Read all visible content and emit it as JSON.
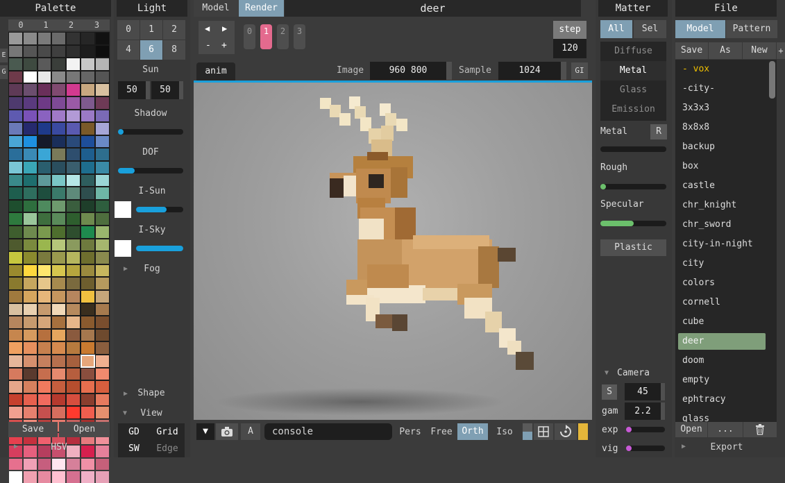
{
  "palette": {
    "title": "Palette",
    "tabs": [
      "0",
      "1",
      "2",
      "3"
    ],
    "side_tabs": [
      "E",
      "G"
    ],
    "save": "Save",
    "open": "Open",
    "hsv": "HSV",
    "colors": [
      "#9a9a9a",
      "#8a8a8a",
      "#7a7a7a",
      "#6a6a6a",
      "#333333",
      "#262626",
      "#111111",
      "#777777",
      "#555555",
      "#4a4a4a",
      "#3f3f3f",
      "#2f2f2f",
      "#1d1d1d",
      "#0e0e0e",
      "#4a5a50",
      "#3e4a40",
      "#5a5a5a",
      "#3a3e3a",
      "#f3f3f3",
      "#c7c7c7",
      "#b5b5b5",
      "#6e3a4a",
      "#ffffff",
      "#e8e8e8",
      "#8a8a8a",
      "#777777",
      "#666666",
      "#555555",
      "#5e3a56",
      "#6b4e6e",
      "#6a2f5a",
      "#804a70",
      "#d23a8f",
      "#c8a880",
      "#d8c0a0",
      "#4e3a6e",
      "#5a3a7e",
      "#6e3a86",
      "#7e4a96",
      "#9a5aa6",
      "#7e5a8e",
      "#6e3a56",
      "#5e5ab0",
      "#7a52b8",
      "#8a62c0",
      "#a07ac8",
      "#b29ad6",
      "#9a7ac6",
      "#7a6ab6",
      "#6a7ab8",
      "#262a6e",
      "#1e3a8a",
      "#3a4aa0",
      "#5a5ab0",
      "#7a5a2a",
      "#a6a6d6",
      "#4aa6d6",
      "#1e90e0",
      "#151a2a",
      "#1a2e5a",
      "#2a4a7a",
      "#1e4e9a",
      "#6a8ac6",
      "#2a6e9a",
      "#3a8ab6",
      "#3aa6d6",
      "#7a7a5a",
      "#2e4e6e",
      "#1e5e8e",
      "#2e6e8e",
      "#7ac6d6",
      "#3aa6b6",
      "#2a5e6e",
      "#2a4e5e",
      "#3a5e6e",
      "#1e6e8e",
      "#3a8aa6",
      "#3a8a8a",
      "#1e6e6e",
      "#5e9a9a",
      "#7ac6c6",
      "#b6e6e6",
      "#2e5e5e",
      "#9ad6d6",
      "#1e5e4e",
      "#2e6e5e",
      "#1e4e3e",
      "#3a7a6a",
      "#5e8a7a",
      "#2e4e4e",
      "#6eb6a6",
      "#1e4e2e",
      "#2e6e3e",
      "#4e8a5e",
      "#6e9a6e",
      "#3a5e3e",
      "#1e3e2a",
      "#2e5e3e",
      "#2e7a3e",
      "#9ac69a",
      "#3e6e3e",
      "#5a8a5a",
      "#2e5e2e",
      "#6e8a4e",
      "#4e6e3e",
      "#3e5e2e",
      "#6e8a4e",
      "#7a9a4e",
      "#4e6e2e",
      "#2e4e2e",
      "#1e8a4e",
      "#9ab66e",
      "#4e5a2e",
      "#7a8a3e",
      "#9ab64e",
      "#b6c67a",
      "#8a9a5e",
      "#6e7a3e",
      "#a6b66e",
      "#c6c63e",
      "#8a8a2e",
      "#7a7a3e",
      "#9a9a4e",
      "#b6b65e",
      "#6e6e2e",
      "#8a8a4e",
      "#9a8a2e",
      "#ffd83e",
      "#ffe66e",
      "#d6c64e",
      "#b6a63e",
      "#9a8a3e",
      "#c6b65e",
      "#8a7a2e",
      "#c6a65e",
      "#e6c68a",
      "#a68a4e",
      "#7a6a3e",
      "#6e5e2e",
      "#b69a5e",
      "#a07a3e",
      "#d6a65e",
      "#e6b67a",
      "#c6965e",
      "#b6865e",
      "#f0c040",
      "#c6a67a",
      "#d8c0a0",
      "#e8d0b0",
      "#c69a6e",
      "#f0d8b8",
      "#b68a5e",
      "#3a2e1e",
      "#a67a4e",
      "#b6865e",
      "#c69a6e",
      "#d6a67a",
      "#a6703e",
      "#e6b68a",
      "#8a5a2e",
      "#7a4e2e",
      "#c6864e",
      "#d69a5e",
      "#b6703e",
      "#e6a65e",
      "#8a5a3e",
      "#a6784e",
      "#6e4a2e",
      "#f0a060",
      "#e6905e",
      "#c6804e",
      "#d68a4e",
      "#b67a3e",
      "#c87a30",
      "#8a5e3e",
      "#e6b69a",
      "#d6906e",
      "#c6805e",
      "#b6704e",
      "#a6603e",
      "#e6a67a",
      "#f0b090",
      "#d67a5e",
      "#5a3a2e",
      "#c66e4e",
      "#e68a6e",
      "#b65e3e",
      "#8a4e3e",
      "#f08a6e",
      "#e6a68a",
      "#d6805e",
      "#f07a5e",
      "#c65e3e",
      "#b64e2e",
      "#e66e4e",
      "#d65e3e",
      "#c6402e",
      "#e6604e",
      "#f06a5e",
      "#b63a2e",
      "#d64e3e",
      "#8a3e2e",
      "#e67a5e",
      "#f0a090",
      "#e6806e",
      "#c6504e",
      "#d66e5e",
      "#ff3a2e",
      "#f05e4e",
      "#e6906e",
      "#d6504e",
      "#f08a7a",
      "#b6403e",
      "#e67a6e",
      "#c6605e",
      "#a6302e",
      "#c6706e",
      "#e6404e",
      "#c6303e",
      "#f0606e",
      "#d6505e",
      "#b62e3e",
      "#e67a7e",
      "#f0909a",
      "#d63e5e",
      "#e6607e",
      "#b63e5e",
      "#c6506e",
      "#f0b0c0",
      "#d6204e",
      "#e6809a",
      "#e6708e",
      "#f0a0b6",
      "#c65e7e",
      "#ffe6f0",
      "#d6809a",
      "#f090a6",
      "#c6607a",
      "#ffffff",
      "#f0a0b0",
      "#e68aa0",
      "#ffc0d0",
      "#d67090",
      "#f0b0c6",
      "#e6a0b6"
    ]
  },
  "light": {
    "title": "Light",
    "nums_row1": [
      "0",
      "1",
      "2"
    ],
    "nums_row2": [
      "4",
      "6",
      "8"
    ],
    "sun_label": "Sun",
    "sun_values": [
      "50",
      "50"
    ],
    "shadow_label": "Shadow",
    "shadow_value": 0.05,
    "dof_label": "DOF",
    "dof_value": 0.25,
    "isun_label": "I-Sun",
    "isun_value": 0.65,
    "isky_label": "I-Sky",
    "isky_value": 1.0,
    "fog_label": "Fog",
    "shape_label": "Shape",
    "view_label": "View",
    "view_buttons": [
      "GD",
      "Grid",
      "SW",
      "Edge"
    ]
  },
  "top": {
    "tab_model": "Model",
    "tab_render": "Render",
    "title": "deer",
    "frames": [
      "0",
      "1",
      "2",
      "3"
    ],
    "step_label": "step",
    "step_value": "120",
    "anim_tab": "anim",
    "image_label": "Image",
    "image_value": "960 800",
    "sample_label": "Sample",
    "sample_value": "1024",
    "gi": "GI",
    "arrow_left": "◀",
    "arrow_right": "▶",
    "minus": "-",
    "plus": "+"
  },
  "bottom": {
    "console": "console",
    "a_btn": "A",
    "projections": [
      "Pers",
      "Free",
      "Orth",
      "Iso"
    ]
  },
  "matter": {
    "title": "Matter",
    "tab_all": "All",
    "tab_sel": "Sel",
    "materials": [
      "Diffuse",
      "Metal",
      "Glass",
      "Emission"
    ],
    "metal_label": "Metal",
    "metal_reset": "R",
    "metal_value": 0.0,
    "rough_label": "Rough",
    "rough_value": 0.05,
    "specular_label": "Specular",
    "specular_value": 0.5,
    "plastic": "Plastic",
    "camera_label": "Camera",
    "s_btn": "S",
    "fov_value": "45",
    "gam_label": "gam",
    "gam_value": "2.2",
    "exp_label": "exp",
    "exp_value": 0.1,
    "vig_label": "vig",
    "vig_value": 0.05
  },
  "file": {
    "title": "File",
    "tab_model": "Model",
    "tab_pattern": "Pattern",
    "save": "Save",
    "as": "As",
    "new": "New",
    "plus": "+",
    "items": [
      "- vox",
      "-city-",
      "3x3x3",
      "8x8x8",
      "backup",
      "box",
      "castle",
      "chr_knight",
      "chr_sword",
      "city-in-night",
      "city",
      "colors",
      "cornell",
      "cube",
      "deer",
      "doom",
      "empty",
      "ephtracy",
      "glass"
    ],
    "selected": "deer",
    "open": "Open",
    "more": "...",
    "export": "Export"
  }
}
